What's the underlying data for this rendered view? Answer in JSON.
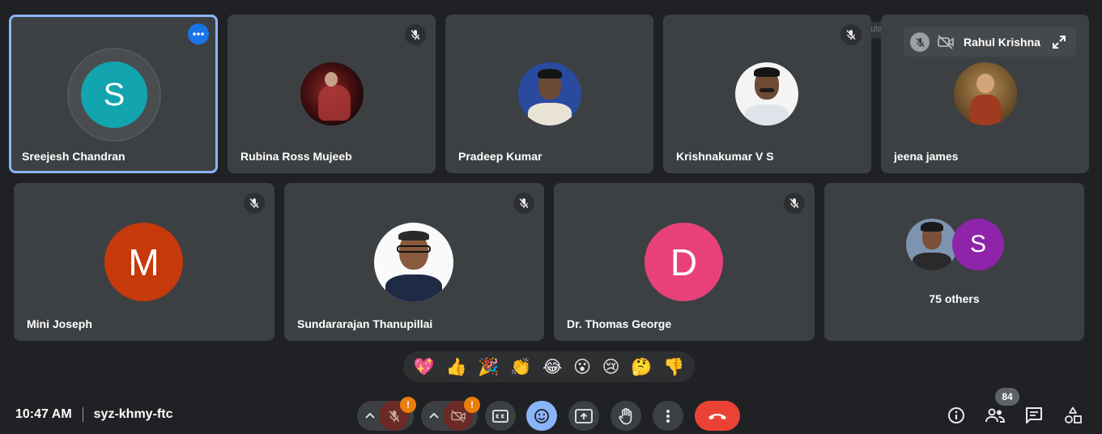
{
  "tiles": {
    "t1": {
      "name": "Sreejesh Chandran",
      "initial": "S",
      "color": "#12a4af"
    },
    "t2": {
      "name": "Rubina Ross Mujeeb"
    },
    "t3": {
      "name": "Pradeep Kumar"
    },
    "t4": {
      "name": "Krishnakumar V S"
    },
    "t5": {
      "name": "jeena james"
    },
    "t6": {
      "name": "Mini Joseph",
      "initial": "M",
      "color": "#c5390b"
    },
    "t7": {
      "name": "Sundararajan Thanupillai"
    },
    "t8": {
      "name": "Dr. Thomas George",
      "initial": "D",
      "color": "#e8417a"
    },
    "t9": {
      "others_label": "75 others",
      "second_initial": "S",
      "second_color": "#8e24aa"
    }
  },
  "pip": {
    "name": "Rahul Krishna",
    "ghost_text": "Rectangular Snip"
  },
  "reactions": [
    "💖",
    "👍",
    "🎉",
    "👏",
    "😂",
    "😮",
    "😢",
    "🤔",
    "👎"
  ],
  "meeting": {
    "time": "10:47 AM",
    "code": "syz-khmy-ftc"
  },
  "controls": {
    "mic_warning": "!",
    "cam_warning": "!"
  },
  "participants_count": "84",
  "colors": {
    "end_call": "#ea4335",
    "reactions_active": "#8ab4f8",
    "tile_bg": "#3c4043",
    "page_bg": "#202124"
  }
}
